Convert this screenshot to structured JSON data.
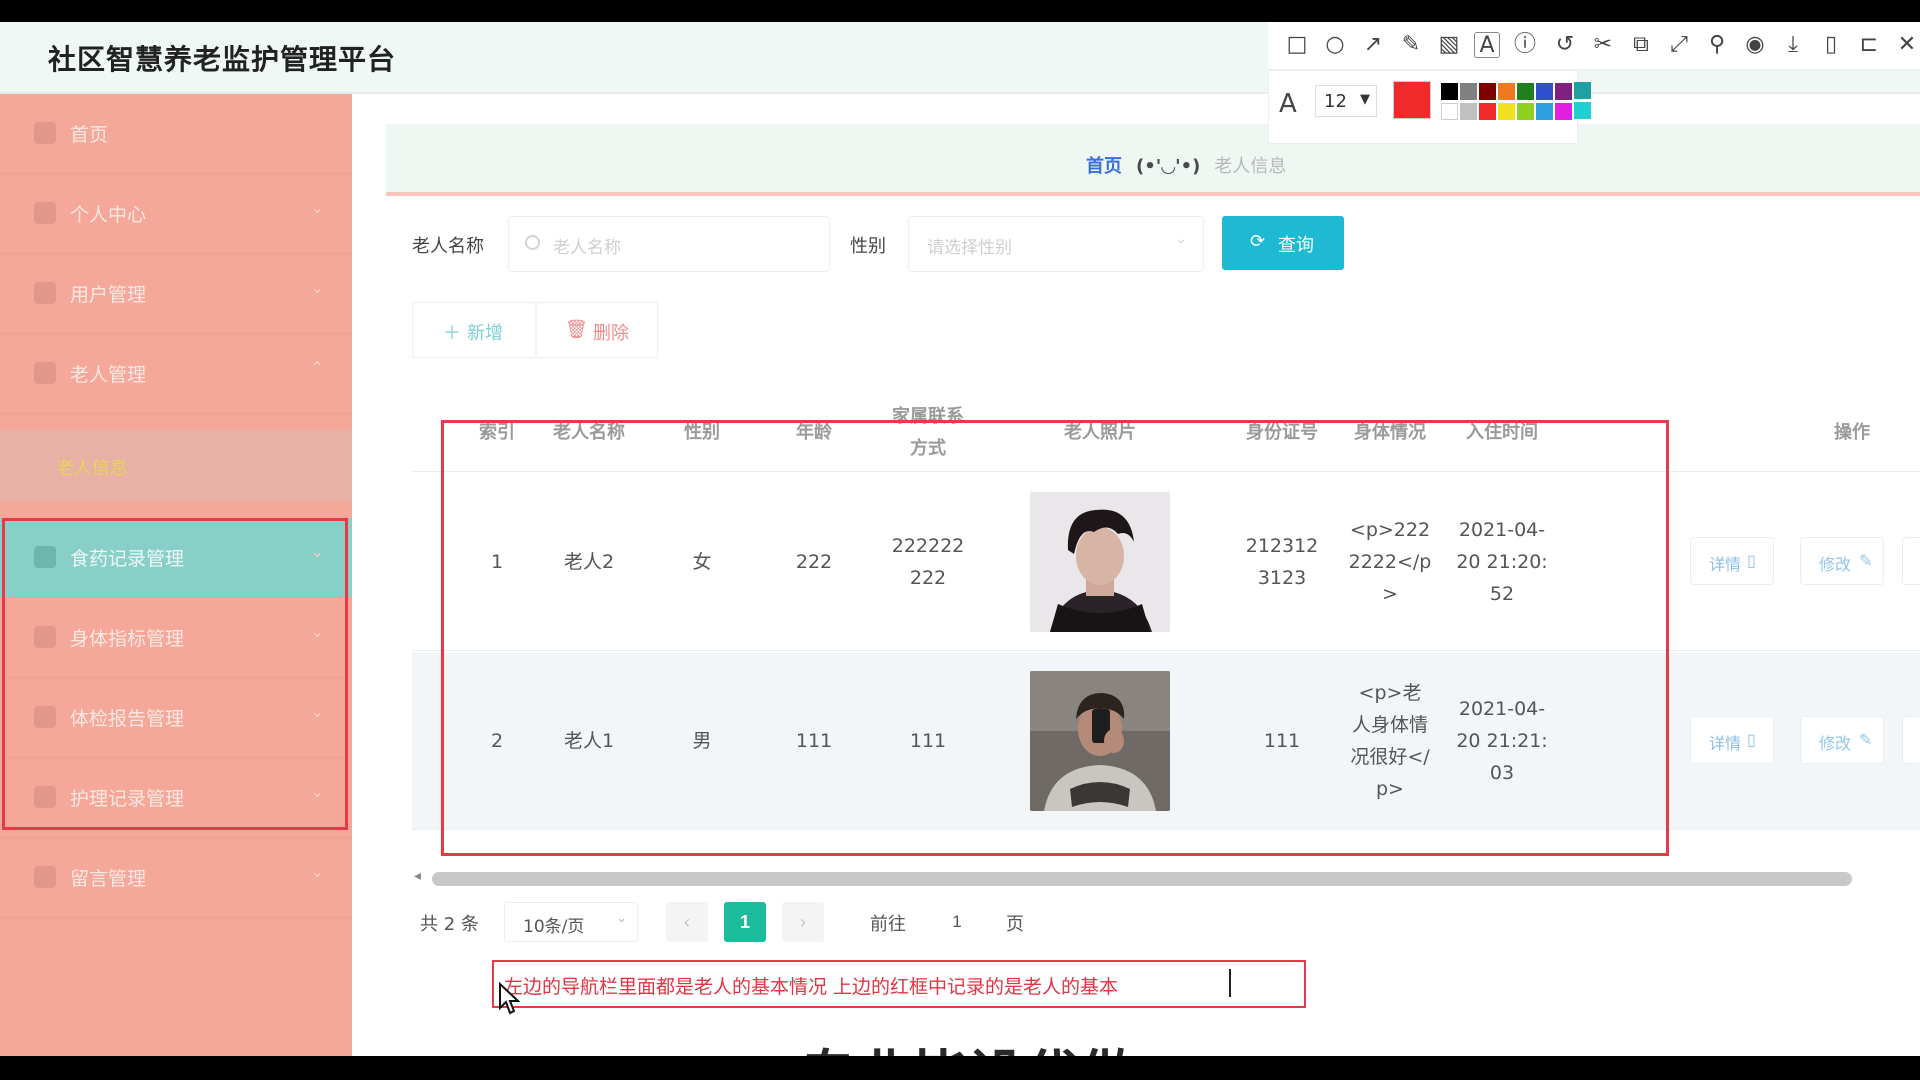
{
  "app": {
    "title": "社区智慧养老监护管理平台"
  },
  "sidebar": {
    "items": [
      {
        "label": "首页",
        "icon": "home-icon"
      },
      {
        "label": "个人中心",
        "icon": "user-icon"
      },
      {
        "label": "用户管理",
        "icon": "list-icon"
      },
      {
        "label": "老人管理",
        "icon": "list-icon"
      },
      {
        "label": "老人信息",
        "icon": ""
      },
      {
        "label": "食药记录管理",
        "icon": "user-icon"
      },
      {
        "label": "身体指标管理",
        "icon": "chart-icon"
      },
      {
        "label": "体检报告管理",
        "icon": "report-icon"
      },
      {
        "label": "护理记录管理",
        "icon": "clipboard-icon"
      },
      {
        "label": "留言管理",
        "icon": "message-icon"
      }
    ]
  },
  "breadcrumb": {
    "home": "首页",
    "separator": "(•'◡'•)",
    "current": "老人信息"
  },
  "search": {
    "name_label": "老人名称",
    "name_placeholder": "老人名称",
    "gender_label": "性别",
    "gender_placeholder": "请选择性别",
    "query_label": "查询"
  },
  "toolbar": {
    "add_label": "新增",
    "delete_label": "删除"
  },
  "table": {
    "headers": [
      "索引",
      "老人名称",
      "性别",
      "年龄",
      "家属联系方式",
      "老人照片",
      "身份证号",
      "身体情况",
      "入住时间",
      "操作"
    ],
    "rows": [
      {
        "index": "1",
        "name": "老人2",
        "gender": "女",
        "age": "222",
        "contact": "222222222",
        "id_no": "2123123123",
        "health": "<p>2222222</p>",
        "checkin": "2021-04-20 21:20:52"
      },
      {
        "index": "2",
        "name": "老人1",
        "gender": "男",
        "age": "111",
        "contact": "111",
        "id_no": "111",
        "health": "<p>老人身体情况很好</p>",
        "checkin": "2021-04-20 21:21:03"
      }
    ],
    "detail_label": "详情",
    "edit_label": "修改"
  },
  "pagination": {
    "total": "共 2 条",
    "page_size": "10条/页",
    "current_page": "1",
    "goto_label": "前往",
    "goto_value": "1",
    "page_suffix": "页"
  },
  "annotation": {
    "note_text": "左边的导航栏里面都是老人的基本情况 上边的红框中记录的是老人的基本",
    "font_size": "12",
    "active_color": "#f02a2a"
  },
  "banner": {
    "text": "专业毕设代做"
  },
  "colors": {
    "sidebar_bg": "#f5a89a",
    "sidebar_active": "#88cfc7",
    "accent": "#1fb9d4",
    "page_active": "#1abc9c",
    "highlight": "#e63a45"
  }
}
